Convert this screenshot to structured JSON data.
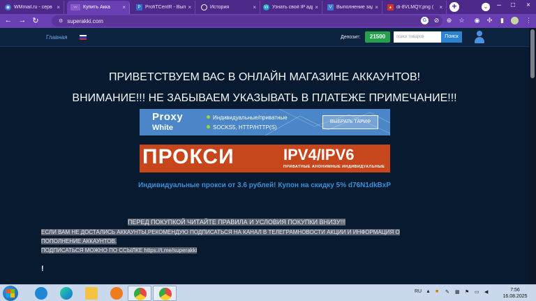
{
  "tabs": [
    {
      "label": "WMmail.ru - серв",
      "icon_color": "#3a7bd5",
      "active": false
    },
    {
      "label": "Купить Акка",
      "icon_color": "#d6b3ff",
      "active": true
    },
    {
      "label": "ProfiTCentR - Вып",
      "icon_color": "#2b6fd6",
      "active": false
    },
    {
      "label": "История",
      "icon_color": "#7a7a7a",
      "active": false
    },
    {
      "label": "Узнать свой IP адр",
      "icon_color": "#1aa0c9",
      "active": false
    },
    {
      "label": "Выполнение зада",
      "icon_color": "#3a7bd5",
      "active": false
    },
    {
      "label": "di-8VLMQY.png (",
      "icon_color": "#d93025",
      "active": false
    }
  ],
  "address": {
    "url": "superakki.com"
  },
  "header": {
    "home_link": "Главная",
    "deposit_label": "Депозит:",
    "deposit_value": "21500",
    "search_placeholder": "поиск товаров",
    "search_button": "Поиск"
  },
  "main": {
    "welcome": "ПРИВЕТСТВУЕМ ВАС В ОНЛАЙН МАГАЗИНЕ АККАУНТОВ!",
    "attention": "ВНИМАНИЕ!!! НЕ ЗАБЫВАЕМ УКАЗЫВАТЬ В ПЛАТЕЖЕ ПРИМЕЧАНИЕ!!!",
    "proxy_banner": {
      "brand_line1": "Proxy",
      "brand_line2": "White",
      "line1": "Индивидуальные/приватные",
      "line2": "SOCKS5, HTTP/HTTP(S)",
      "button": "ВЫБРАТЬ ТАРИФ"
    },
    "ipv_banner": {
      "big": "ПРОКСИ",
      "ipv": "IPV4/IPV6",
      "sub": "ПРИВАТНЫЕ АНОНИМНЫЕ ИНДИВИДУАЛЬНЫЕ"
    },
    "promo": "Индивидуальные прокси от 3.6 рублей! Купон на скидку 5% d76N1dkBxP",
    "rules": "ПЕРЕД ПОКУПКОЙ ЧИТАЙТЕ ПРАВИЛА И УСЛОВИЯ ПОКУПКИ ВНИЗУ!!!",
    "advice_line1": "ЕСЛИ ВАМ НЕ ДОСТАЛИСЬ АККАУНТЫ,РЕКОМЕНДУЮ ПОДПИСАТЬСЯ НА КАНАЛ В ТЕЛЕГРАМНОВОСТИ АКЦИИ И ИНФОРМАЦИЯ О",
    "advice_line2": "ПОПОЛНЕНИЕ АККАУНТОВ.",
    "subscribe": "ПОДПИСАТЬСЯ МОЖНО ПО ССЫЛКЕ https://t.me/superakki",
    "exclamation": "!"
  },
  "taskbar": {
    "lang": "RU",
    "time": "7:56",
    "date": "16.08.2025"
  },
  "colors": {
    "tab_strip": "#4d2a8a",
    "page_bg": "#071a30",
    "deposit_green": "#22a24a",
    "search_blue": "#2b84d2",
    "promo_blue": "#3b8ed6",
    "ipv_orange": "#c8461c"
  }
}
